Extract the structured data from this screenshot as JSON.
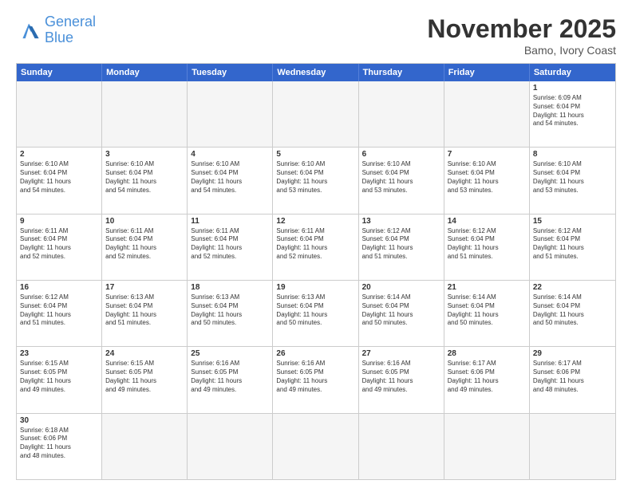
{
  "header": {
    "logo_general": "General",
    "logo_blue": "Blue",
    "month_title": "November 2025",
    "location": "Bamo, Ivory Coast"
  },
  "days_of_week": [
    "Sunday",
    "Monday",
    "Tuesday",
    "Wednesday",
    "Thursday",
    "Friday",
    "Saturday"
  ],
  "rows": [
    [
      {
        "day": "",
        "text": "",
        "empty": true
      },
      {
        "day": "",
        "text": "",
        "empty": true
      },
      {
        "day": "",
        "text": "",
        "empty": true
      },
      {
        "day": "",
        "text": "",
        "empty": true
      },
      {
        "day": "",
        "text": "",
        "empty": true
      },
      {
        "day": "",
        "text": "",
        "empty": true
      },
      {
        "day": "1",
        "text": "Sunrise: 6:09 AM\nSunset: 6:04 PM\nDaylight: 11 hours\nand 54 minutes.",
        "empty": false
      }
    ],
    [
      {
        "day": "2",
        "text": "Sunrise: 6:10 AM\nSunset: 6:04 PM\nDaylight: 11 hours\nand 54 minutes.",
        "empty": false
      },
      {
        "day": "3",
        "text": "Sunrise: 6:10 AM\nSunset: 6:04 PM\nDaylight: 11 hours\nand 54 minutes.",
        "empty": false
      },
      {
        "day": "4",
        "text": "Sunrise: 6:10 AM\nSunset: 6:04 PM\nDaylight: 11 hours\nand 54 minutes.",
        "empty": false
      },
      {
        "day": "5",
        "text": "Sunrise: 6:10 AM\nSunset: 6:04 PM\nDaylight: 11 hours\nand 53 minutes.",
        "empty": false
      },
      {
        "day": "6",
        "text": "Sunrise: 6:10 AM\nSunset: 6:04 PM\nDaylight: 11 hours\nand 53 minutes.",
        "empty": false
      },
      {
        "day": "7",
        "text": "Sunrise: 6:10 AM\nSunset: 6:04 PM\nDaylight: 11 hours\nand 53 minutes.",
        "empty": false
      },
      {
        "day": "8",
        "text": "Sunrise: 6:10 AM\nSunset: 6:04 PM\nDaylight: 11 hours\nand 53 minutes.",
        "empty": false
      }
    ],
    [
      {
        "day": "9",
        "text": "Sunrise: 6:11 AM\nSunset: 6:04 PM\nDaylight: 11 hours\nand 52 minutes.",
        "empty": false
      },
      {
        "day": "10",
        "text": "Sunrise: 6:11 AM\nSunset: 6:04 PM\nDaylight: 11 hours\nand 52 minutes.",
        "empty": false
      },
      {
        "day": "11",
        "text": "Sunrise: 6:11 AM\nSunset: 6:04 PM\nDaylight: 11 hours\nand 52 minutes.",
        "empty": false
      },
      {
        "day": "12",
        "text": "Sunrise: 6:11 AM\nSunset: 6:04 PM\nDaylight: 11 hours\nand 52 minutes.",
        "empty": false
      },
      {
        "day": "13",
        "text": "Sunrise: 6:12 AM\nSunset: 6:04 PM\nDaylight: 11 hours\nand 51 minutes.",
        "empty": false
      },
      {
        "day": "14",
        "text": "Sunrise: 6:12 AM\nSunset: 6:04 PM\nDaylight: 11 hours\nand 51 minutes.",
        "empty": false
      },
      {
        "day": "15",
        "text": "Sunrise: 6:12 AM\nSunset: 6:04 PM\nDaylight: 11 hours\nand 51 minutes.",
        "empty": false
      }
    ],
    [
      {
        "day": "16",
        "text": "Sunrise: 6:12 AM\nSunset: 6:04 PM\nDaylight: 11 hours\nand 51 minutes.",
        "empty": false
      },
      {
        "day": "17",
        "text": "Sunrise: 6:13 AM\nSunset: 6:04 PM\nDaylight: 11 hours\nand 51 minutes.",
        "empty": false
      },
      {
        "day": "18",
        "text": "Sunrise: 6:13 AM\nSunset: 6:04 PM\nDaylight: 11 hours\nand 50 minutes.",
        "empty": false
      },
      {
        "day": "19",
        "text": "Sunrise: 6:13 AM\nSunset: 6:04 PM\nDaylight: 11 hours\nand 50 minutes.",
        "empty": false
      },
      {
        "day": "20",
        "text": "Sunrise: 6:14 AM\nSunset: 6:04 PM\nDaylight: 11 hours\nand 50 minutes.",
        "empty": false
      },
      {
        "day": "21",
        "text": "Sunrise: 6:14 AM\nSunset: 6:04 PM\nDaylight: 11 hours\nand 50 minutes.",
        "empty": false
      },
      {
        "day": "22",
        "text": "Sunrise: 6:14 AM\nSunset: 6:04 PM\nDaylight: 11 hours\nand 50 minutes.",
        "empty": false
      }
    ],
    [
      {
        "day": "23",
        "text": "Sunrise: 6:15 AM\nSunset: 6:05 PM\nDaylight: 11 hours\nand 49 minutes.",
        "empty": false
      },
      {
        "day": "24",
        "text": "Sunrise: 6:15 AM\nSunset: 6:05 PM\nDaylight: 11 hours\nand 49 minutes.",
        "empty": false
      },
      {
        "day": "25",
        "text": "Sunrise: 6:16 AM\nSunset: 6:05 PM\nDaylight: 11 hours\nand 49 minutes.",
        "empty": false
      },
      {
        "day": "26",
        "text": "Sunrise: 6:16 AM\nSunset: 6:05 PM\nDaylight: 11 hours\nand 49 minutes.",
        "empty": false
      },
      {
        "day": "27",
        "text": "Sunrise: 6:16 AM\nSunset: 6:05 PM\nDaylight: 11 hours\nand 49 minutes.",
        "empty": false
      },
      {
        "day": "28",
        "text": "Sunrise: 6:17 AM\nSunset: 6:06 PM\nDaylight: 11 hours\nand 49 minutes.",
        "empty": false
      },
      {
        "day": "29",
        "text": "Sunrise: 6:17 AM\nSunset: 6:06 PM\nDaylight: 11 hours\nand 48 minutes.",
        "empty": false
      }
    ],
    [
      {
        "day": "30",
        "text": "Sunrise: 6:18 AM\nSunset: 6:06 PM\nDaylight: 11 hours\nand 48 minutes.",
        "empty": false
      },
      {
        "day": "",
        "text": "",
        "empty": true
      },
      {
        "day": "",
        "text": "",
        "empty": true
      },
      {
        "day": "",
        "text": "",
        "empty": true
      },
      {
        "day": "",
        "text": "",
        "empty": true
      },
      {
        "day": "",
        "text": "",
        "empty": true
      },
      {
        "day": "",
        "text": "",
        "empty": true
      }
    ]
  ]
}
